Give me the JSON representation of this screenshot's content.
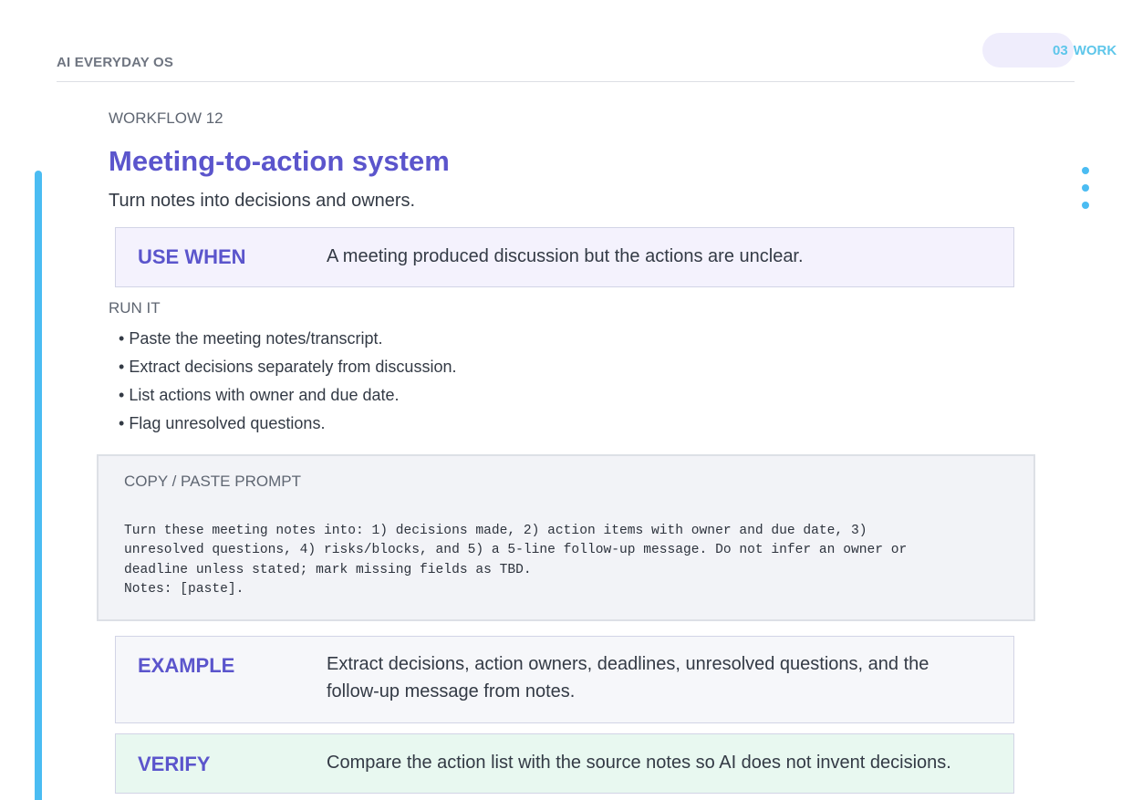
{
  "header": {
    "brand": "AI EVERYDAY OS",
    "section_number": "03",
    "section_name": "WORK"
  },
  "workflow": {
    "number_label": "WORKFLOW 12",
    "title": "Meeting-to-action system",
    "subtitle": "Turn notes into decisions and owners."
  },
  "use_when": {
    "label": "USE WHEN",
    "text": "A meeting produced discussion but the actions are unclear."
  },
  "run_it": {
    "label": "RUN IT",
    "steps": [
      "Paste the meeting notes/transcript.",
      "Extract decisions separately from discussion.",
      "List actions with owner and due date.",
      "Flag unresolved questions."
    ]
  },
  "prompt": {
    "label": "COPY / PASTE PROMPT",
    "text": "Turn these meeting notes into: 1) decisions made, 2) action items with owner and due date, 3)\nunresolved questions, 4) risks/blocks, and 5) a 5-line follow-up message. Do not infer an owner or\ndeadline unless stated; mark missing fields as TBD.\nNotes: [paste]."
  },
  "example": {
    "label": "EXAMPLE",
    "text": "Extract decisions, action owners, deadlines, unresolved questions, and the follow-up message from notes."
  },
  "verify": {
    "label": "VERIFY",
    "text": "Compare the action list with the source notes so AI does not invent decisions."
  },
  "colors": {
    "accent_purple": "#5b55cc",
    "accent_blue": "#4bbcf2",
    "section_label": "#5ec6ea",
    "use_when_bg": "#f4f2fd",
    "verify_bg": "#e8f8f0",
    "prompt_bg": "#f2f3f7"
  }
}
